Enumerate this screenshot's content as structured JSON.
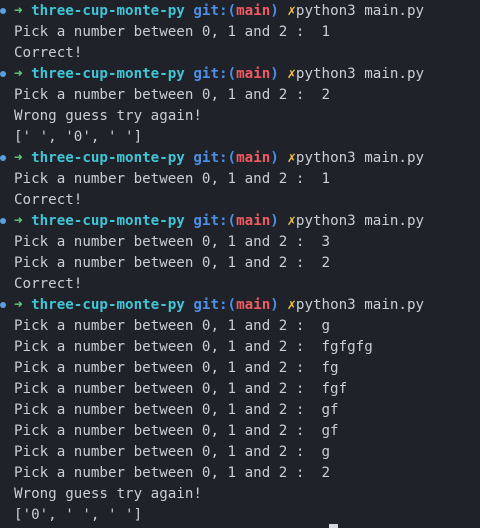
{
  "terminal": {
    "lines": [
      {
        "type": "prompt",
        "arrow": "➜",
        "dir": "three-cup-monte-py",
        "git": "git:(",
        "branch": "main",
        "git_close": ")",
        "dirty": "✗",
        "command": "python3 main.py"
      },
      {
        "type": "output",
        "text": "Pick a number between 0, 1 and 2 :  1"
      },
      {
        "type": "output",
        "text": "Correct!"
      },
      {
        "type": "prompt",
        "arrow": "➜",
        "dir": "three-cup-monte-py",
        "git": "git:(",
        "branch": "main",
        "git_close": ")",
        "dirty": "✗",
        "command": "python3 main.py"
      },
      {
        "type": "output",
        "text": "Pick a number between 0, 1 and 2 :  2"
      },
      {
        "type": "output",
        "text": "Wrong guess try again!"
      },
      {
        "type": "output",
        "text": "[' ', '0', ' ']"
      },
      {
        "type": "prompt",
        "arrow": "➜",
        "dir": "three-cup-monte-py",
        "git": "git:(",
        "branch": "main",
        "git_close": ")",
        "dirty": "✗",
        "command": "python3 main.py"
      },
      {
        "type": "output",
        "text": "Pick a number between 0, 1 and 2 :  1"
      },
      {
        "type": "output",
        "text": "Correct!"
      },
      {
        "type": "prompt",
        "arrow": "➜",
        "dir": "three-cup-monte-py",
        "git": "git:(",
        "branch": "main",
        "git_close": ")",
        "dirty": "✗",
        "command": "python3 main.py"
      },
      {
        "type": "output",
        "text": "Pick a number between 0, 1 and 2 :  3"
      },
      {
        "type": "output",
        "text": "Pick a number between 0, 1 and 2 :  2"
      },
      {
        "type": "output",
        "text": "Correct!"
      },
      {
        "type": "prompt",
        "arrow": "➜",
        "dir": "three-cup-monte-py",
        "git": "git:(",
        "branch": "main",
        "git_close": ")",
        "dirty": "✗",
        "command": "python3 main.py"
      },
      {
        "type": "output",
        "text": "Pick a number between 0, 1 and 2 :  g"
      },
      {
        "type": "output",
        "text": "Pick a number between 0, 1 and 2 :  fgfgfg"
      },
      {
        "type": "output",
        "text": "Pick a number between 0, 1 and 2 :  fg"
      },
      {
        "type": "output",
        "text": "Pick a number between 0, 1 and 2 :  fgf"
      },
      {
        "type": "output",
        "text": "Pick a number between 0, 1 and 2 :  gf"
      },
      {
        "type": "output",
        "text": "Pick a number between 0, 1 and 2 :  gf"
      },
      {
        "type": "output",
        "text": "Pick a number between 0, 1 and 2 :  g"
      },
      {
        "type": "output",
        "text": "Pick a number between 0, 1 and 2 :  2"
      },
      {
        "type": "output",
        "text": "Wrong guess try again!"
      },
      {
        "type": "output",
        "text": "['0', ' ', ' ']"
      }
    ]
  },
  "colors": {
    "background": "#1f2329",
    "text": "#c9ced6",
    "arrow": "#5fd17a",
    "dir": "#41c5d6",
    "git": "#4d8fe8",
    "branch": "#ef5a63",
    "dirty": "#f0c24a",
    "marker": "#5aa0e0"
  }
}
